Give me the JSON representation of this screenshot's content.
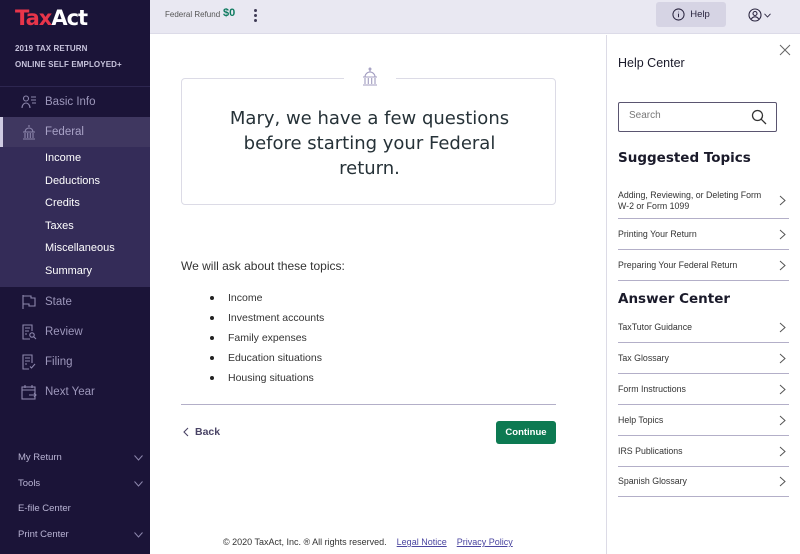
{
  "brand": {
    "logo_part1": "Tax",
    "logo_part2": "Act",
    "product_line1": "2019 TAX RETURN",
    "product_line2": "ONLINE SELF EMPLOYED+",
    "accent_red": "#e8354a"
  },
  "sidebar": {
    "main_items": [
      {
        "label": "Basic Info",
        "icon": "person-list-icon",
        "active": false
      },
      {
        "label": "Federal",
        "icon": "capitol-icon",
        "active": true
      },
      {
        "label": "State",
        "icon": "flag-icon",
        "active": false
      },
      {
        "label": "Review",
        "icon": "document-search-icon",
        "active": false
      },
      {
        "label": "Filing",
        "icon": "document-check-icon",
        "active": false
      },
      {
        "label": "Next Year",
        "icon": "calendar-arrow-icon",
        "active": false
      }
    ],
    "federal_subitems": [
      "Income",
      "Deductions",
      "Credits",
      "Taxes",
      "Miscellaneous",
      "Summary"
    ],
    "bottom_items": [
      {
        "label": "My Return",
        "expandable": true
      },
      {
        "label": "Tools",
        "expandable": true
      },
      {
        "label": "E-file Center",
        "expandable": false
      },
      {
        "label": "Print Center",
        "expandable": true
      }
    ]
  },
  "topbar": {
    "refund_label": "Federal Refund",
    "refund_value": "$0",
    "refund_color": "#0d7a5f",
    "help_label": "Help"
  },
  "main": {
    "card_title": "Mary, we have a few questions before starting your Federal return.",
    "intro": "We will ask about these topics:",
    "topics": [
      "Income",
      "Investment accounts",
      "Family expenses",
      "Education situations",
      "Housing situations"
    ],
    "back_label": "Back",
    "continue_label": "Continue",
    "continue_color": "#0d7a52"
  },
  "footer": {
    "copyright": "© 2020 TaxAct, Inc. ® All rights reserved.",
    "legal_notice": "Legal Notice",
    "privacy_policy": "Privacy Policy"
  },
  "help_panel": {
    "title": "Help Center",
    "search_placeholder": "Search",
    "search_value": "",
    "suggested_heading": "Suggested Topics",
    "suggested": [
      "Adding, Reviewing, or Deleting Form W-2 or Form 1099",
      "Printing Your Return",
      "Preparing Your Federal Return"
    ],
    "answer_heading": "Answer Center",
    "answers": [
      "TaxTutor Guidance",
      "Tax Glossary",
      "Form Instructions",
      "Help Topics",
      "IRS Publications",
      "Spanish Glossary"
    ]
  }
}
